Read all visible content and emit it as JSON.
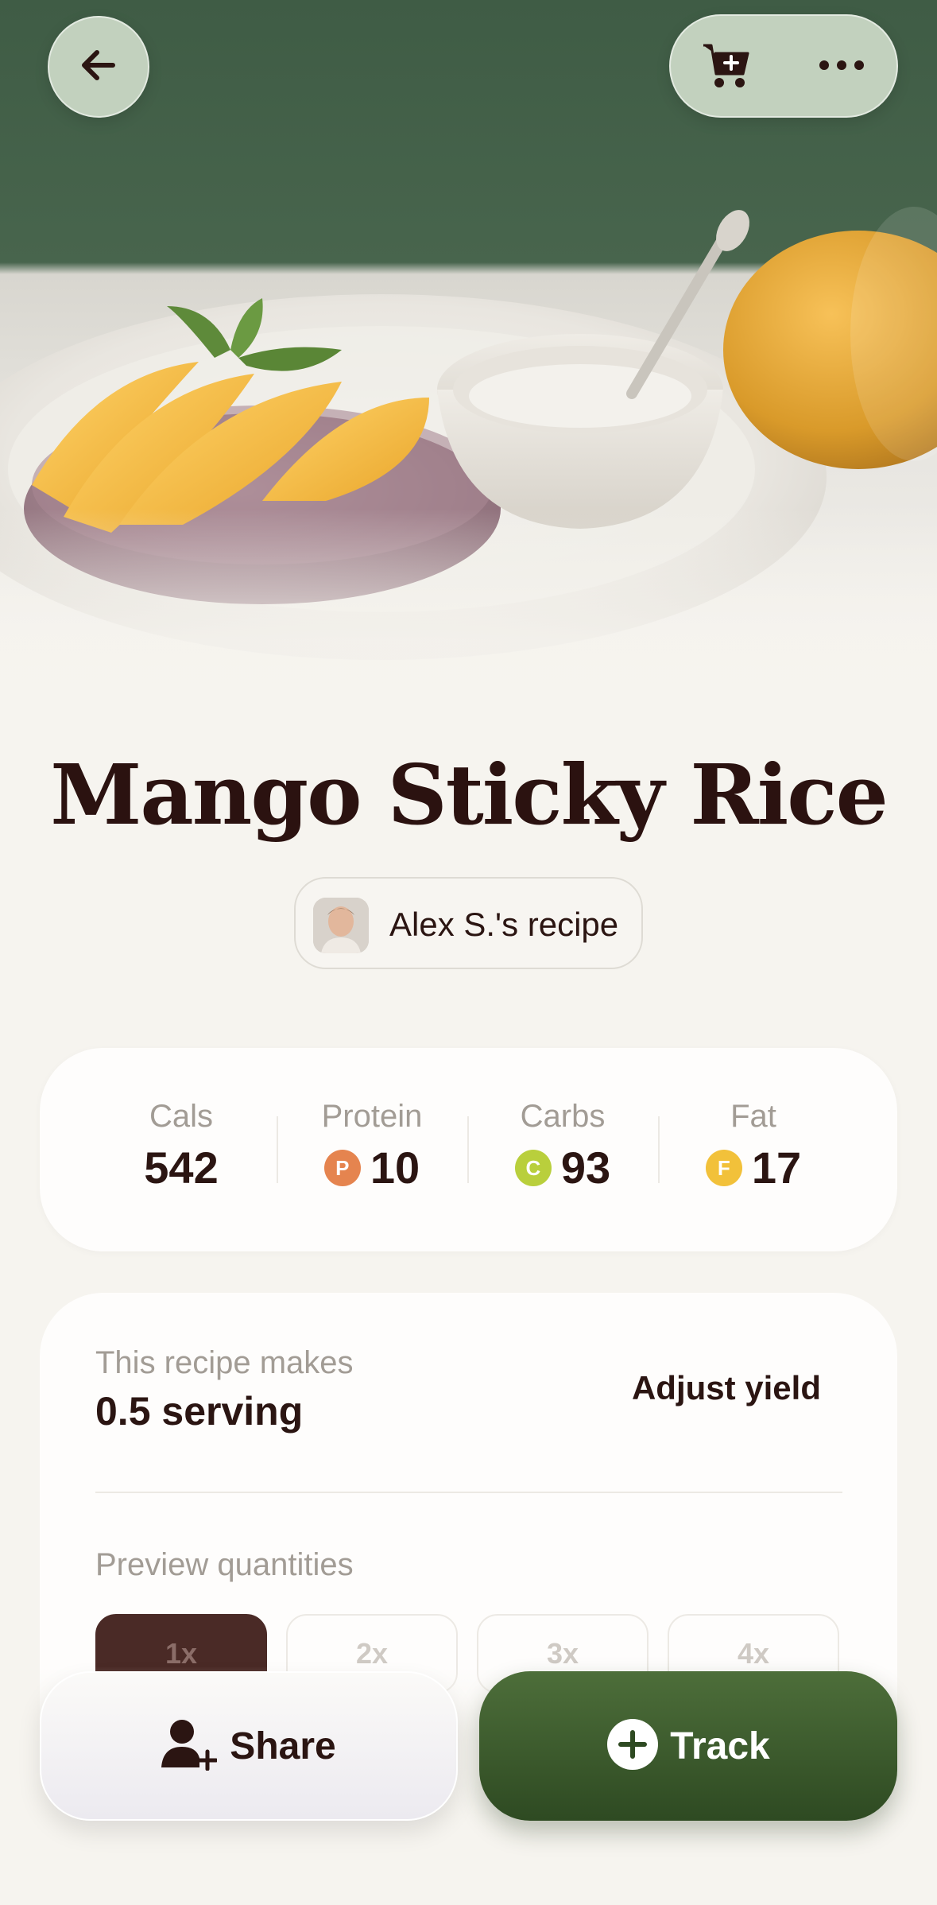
{
  "recipe": {
    "title": "Mango Sticky Rice",
    "author_label": "Alex S.'s recipe"
  },
  "macros": [
    {
      "label": "Cals",
      "value": "542",
      "badge": ""
    },
    {
      "label": "Protein",
      "value": "10",
      "badge": "P",
      "color": "#e5844f"
    },
    {
      "label": "Carbs",
      "value": "93",
      "badge": "C",
      "color": "#b9cf3c"
    },
    {
      "label": "Fat",
      "value": "17",
      "badge": "F",
      "color": "#f2c13a"
    }
  ],
  "yield": {
    "label": "This recipe makes",
    "value": "0.5 serving",
    "adjust_label": "Adjust yield",
    "preview_label": "Preview quantities",
    "multipliers": [
      "1x",
      "2x",
      "3x",
      "4x"
    ],
    "selected": "1x"
  },
  "actions": {
    "share_label": "Share",
    "track_label": "Track"
  },
  "icons": {
    "back": "arrow-left-icon",
    "cart": "cart-plus-icon",
    "more": "more-horizontal-icon",
    "share": "user-plus-icon",
    "track": "plus-circle-icon"
  },
  "colors": {
    "brand_green": "#3c5a2c",
    "text_dark": "#2b1512",
    "muted": "#a29c95"
  }
}
